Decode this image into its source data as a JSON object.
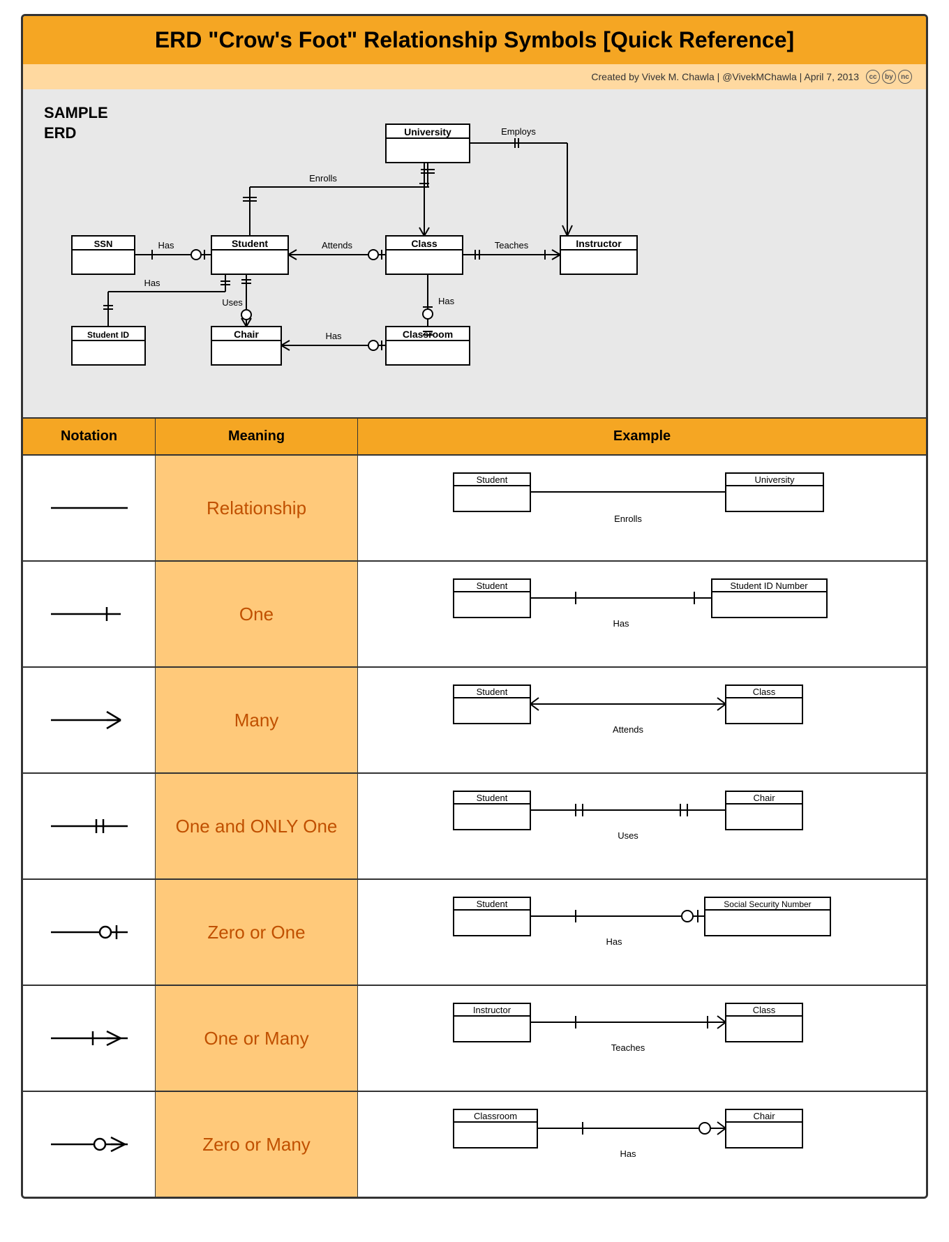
{
  "title": "ERD \"Crow's Foot\" Relationship Symbols [Quick Reference]",
  "subtitle": "Created by Vivek M. Chawla | @VivekMChawla | April 7, 2013",
  "erd_label": "SAMPLE\nERD",
  "table": {
    "headers": [
      "Notation",
      "Meaning",
      "Example"
    ],
    "rows": [
      {
        "meaning": "Relationship",
        "example_left": "Student",
        "example_right": "University",
        "example_rel": "Enrolls"
      },
      {
        "meaning": "One",
        "example_left": "Student",
        "example_right": "Student ID Number",
        "example_rel": "Has"
      },
      {
        "meaning": "Many",
        "example_left": "Student",
        "example_right": "Class",
        "example_rel": "Attends"
      },
      {
        "meaning": "One and ONLY One",
        "example_left": "Student",
        "example_right": "Chair",
        "example_rel": "Uses"
      },
      {
        "meaning": "Zero or One",
        "example_left": "Student",
        "example_right": "Social Security Number",
        "example_rel": "Has"
      },
      {
        "meaning": "One or Many",
        "example_left": "Instructor",
        "example_right": "Class",
        "example_rel": "Teaches"
      },
      {
        "meaning": "Zero or Many",
        "example_left": "Classroom",
        "example_right": "Chair",
        "example_rel": "Has"
      }
    ]
  }
}
